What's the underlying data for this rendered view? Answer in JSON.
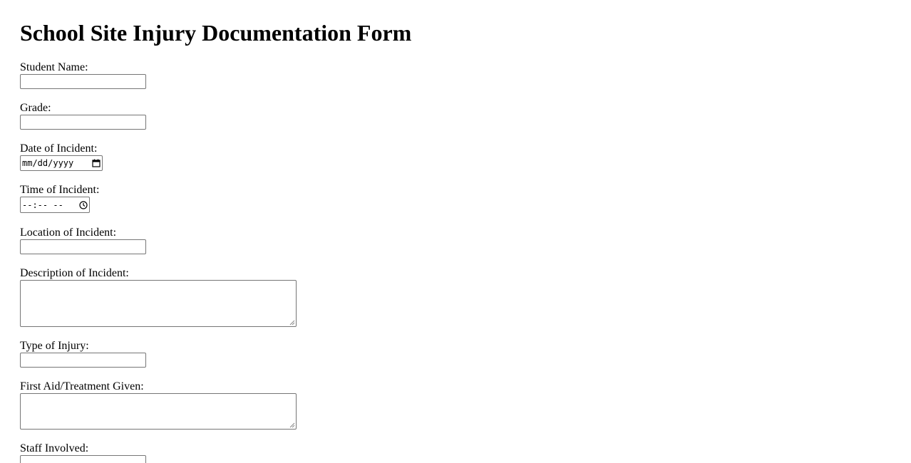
{
  "form": {
    "title": "School Site Injury Documentation Form",
    "fields": {
      "student_name": {
        "label": "Student Name:",
        "value": ""
      },
      "grade": {
        "label": "Grade:",
        "value": ""
      },
      "date": {
        "label": "Date of Incident:",
        "placeholder": "mm/dd/yyyy"
      },
      "time": {
        "label": "Time of Incident:",
        "placeholder": "--:-- --"
      },
      "location": {
        "label": "Location of Incident:",
        "value": ""
      },
      "description": {
        "label": "Description of Incident:",
        "value": ""
      },
      "injury_type": {
        "label": "Type of Injury:",
        "value": ""
      },
      "first_aid": {
        "label": "First Aid/Treatment Given:",
        "value": ""
      },
      "staff": {
        "label": "Staff Involved:",
        "value": ""
      }
    }
  },
  "icons": {
    "date": "calendar-icon",
    "time": "clock-icon"
  }
}
